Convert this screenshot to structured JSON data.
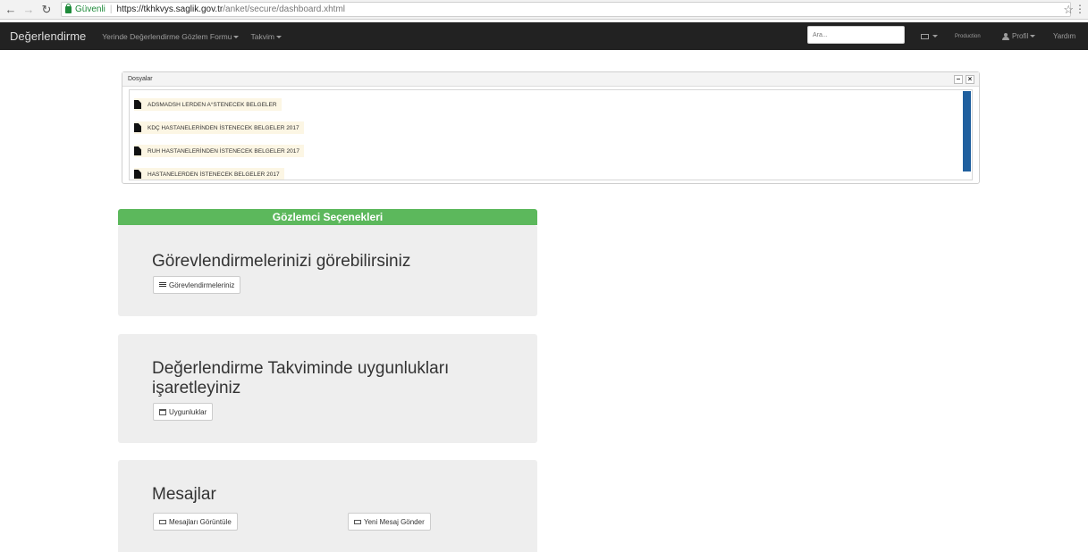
{
  "browser": {
    "secure_label": "Güvenli",
    "url_host": "https://tkhkvys.saglik.gov.tr",
    "url_path": "/anket/secure/dashboard.xhtml"
  },
  "navbar": {
    "brand": "Değerlendirme",
    "menu1": "Yerinde Değerlendirme Gözlem Formu",
    "menu2": "Takvim",
    "search_placeholder": "Ara...",
    "env_label": "Production",
    "profile": "Profil",
    "help": "Yardım"
  },
  "files": {
    "title": "Dosyalar",
    "items": [
      "ADSMADSH LERDEN A°STENECEK BELGELER",
      "KDÇ HASTANELERİNDEN İSTENECEK BELGELER 2017",
      "RUH HASTANELERİNDEN İSTENECEK BELGELER 2017",
      "HASTANELERDEN İSTENECEK BELGELER 2017"
    ]
  },
  "options": {
    "header": "Gözlemci Seçenekleri",
    "card1": {
      "title": "Görevlendirmelerinizi görebilirsiniz",
      "button": "Görevlendirmeleriniz"
    },
    "card2": {
      "title_line1": "Değerlendirme Takviminde uygunlukları",
      "title_line2": "işaretleyiniz",
      "button": "Uygunluklar"
    },
    "card3": {
      "title": "Mesajlar",
      "button1": "Mesajları Görüntüle",
      "button2": "Yeni Mesaj Gönder"
    }
  }
}
